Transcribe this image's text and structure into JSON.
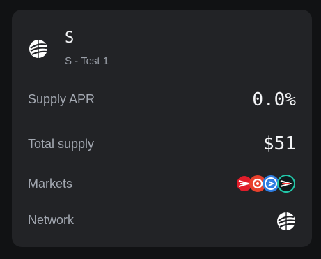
{
  "card": {
    "title": "S",
    "subtitle": "S - Test 1",
    "logo_icon": "sonic-logo-icon"
  },
  "rows": {
    "supply_apr": {
      "label": "Supply APR",
      "value": "0.0%"
    },
    "total_supply": {
      "label": "Total supply",
      "value": "$51"
    },
    "markets": {
      "label": "Markets",
      "icons": [
        "red-market-icon",
        "red-gear-market-icon",
        "blue-market-icon",
        "dark-teal-market-icon"
      ]
    },
    "network": {
      "label": "Network",
      "icon": "sonic-network-icon"
    }
  },
  "colors": {
    "background": "#111214",
    "card": "#222326",
    "text_primary": "#f3f4f6",
    "text_secondary": "#a3a8b1"
  }
}
